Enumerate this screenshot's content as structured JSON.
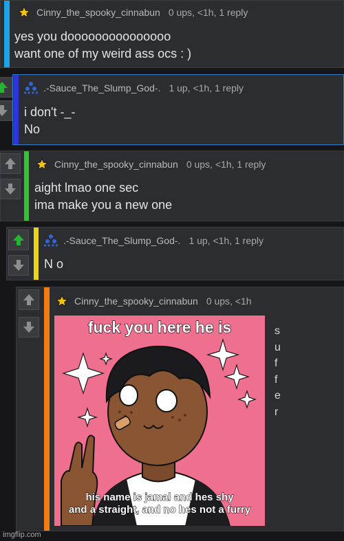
{
  "comments": [
    {
      "username": "Cinny_the_spooky_cinnabun",
      "meta": "0 ups, <1h, 1 reply",
      "icon": "star-icon",
      "bar_color": "#1aa3e8",
      "text": "yes you dooooooooooooooo\nwant one of my weird ass ocs : )"
    },
    {
      "username": ".-Sauce_The_Slump_God-.",
      "meta": "1 up, <1h, 1 reply",
      "icon": "triangle-dots-icon",
      "bar_color": "#2f35d8",
      "text": "i don't -_-\nNo"
    },
    {
      "username": "Cinny_the_spooky_cinnabun",
      "meta": "0 ups, <1h, 1 reply",
      "icon": "star-icon",
      "bar_color": "#31c631",
      "text": "aight lmao one sec\nima make you a new one"
    },
    {
      "username": ".-Sauce_The_Slump_God-.",
      "meta": "1 up, <1h, 1 reply",
      "icon": "triangle-dots-icon",
      "bar_color": "#ecd40e",
      "text": "N o"
    },
    {
      "username": "Cinny_the_spooky_cinnabun",
      "meta": "0 ups, <1h",
      "icon": "star-icon",
      "bar_color": "#f07c12",
      "meme_top": "fuck you here he is",
      "meme_bottom": "his name is jamal and hes shy\nand a straight, and no hes not a furry",
      "side_letters": [
        "s",
        "u",
        "f",
        "f",
        "e",
        "r"
      ]
    }
  ],
  "watermark": "imgflip.com",
  "colors": {
    "upvote_active": "#22b530",
    "vote_inactive": "#8d8e92",
    "star": "#f2c411",
    "meme_background": "#ef6f8f"
  }
}
